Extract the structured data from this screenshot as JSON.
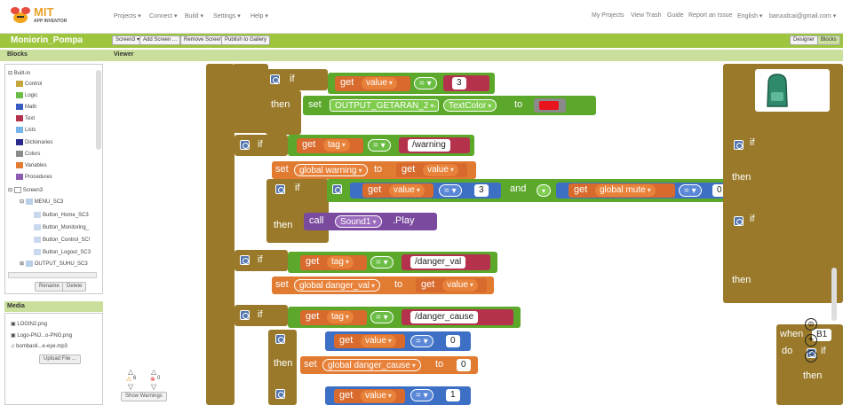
{
  "app": {
    "name": "MIT",
    "subtitle": "APP INVENTOR"
  },
  "nav": {
    "left": [
      "Projects ▾",
      "Connect ▾",
      "Build ▾",
      "Settings ▾",
      "Help ▾"
    ],
    "right": [
      "My Projects",
      "View Trash",
      "Guide",
      "Report an Issue",
      "English ▾",
      "baruudcai@gmail.com ▾"
    ]
  },
  "project": {
    "name": "Moniorin_Pompa",
    "screen_select": "Screen3 ▾",
    "buttons": [
      "Add Screen ...",
      "Remove Screen",
      "Publish to Gallery"
    ],
    "designer": "Designer",
    "blocks": "Blocks"
  },
  "sections": {
    "blocks": "Blocks",
    "viewer": "Viewer",
    "media": "Media"
  },
  "tree": {
    "builtin": "Built-in",
    "builtins": [
      {
        "label": "Control",
        "color": "#c4a43b"
      },
      {
        "label": "Logic",
        "color": "#6cbd45"
      },
      {
        "label": "Math",
        "color": "#3a5cc0"
      },
      {
        "label": "Text",
        "color": "#b5324d"
      },
      {
        "label": "Lists",
        "color": "#74b4e8"
      },
      {
        "label": "Dictionaries",
        "color": "#2a2a8e"
      },
      {
        "label": "Colors",
        "color": "#8a8a8a"
      },
      {
        "label": "Variables",
        "color": "#e07b31"
      },
      {
        "label": "Procedures",
        "color": "#8c5cb0"
      }
    ],
    "screen": "Screen3",
    "menu": "MENU_SC3",
    "children": [
      "Button_Home_SC3",
      "Button_Monitoring_",
      "Button_Control_SC!",
      "Button_Logout_SC3"
    ],
    "output": "OUTPUT_SUHU_SC3",
    "rename": "Rename",
    "delete": "Delete"
  },
  "media": {
    "files": [
      "LOGIN2.png",
      "Logo-PNJ...o-PNG.png",
      "bombasti...e-eye.mp3"
    ],
    "upload": "Upload File ..."
  },
  "warnings": {
    "warn_count": "6",
    "err_count": "0",
    "show": "Show Warnings"
  },
  "blocks": {
    "if": "if",
    "then": "then",
    "get": "get",
    "set": "set",
    "to": "to",
    "and": "and",
    "call": "call",
    "eq": "= ▾",
    "value": "value",
    "tag": "tag",
    "val3": "3",
    "output_comp": "OUTPUT_GETARAN_2",
    "text_color": "TextColor",
    "warning_str": "/warning",
    "global_warning": "global warning",
    "global_mute": "global mute",
    "num3": "3",
    "num0": "0",
    "sound": "Sound1",
    "play": ".Play",
    "danger_val_str": "/danger_val",
    "global_danger_val": "global danger_val",
    "danger_cause_str": "/danger_cause",
    "global_danger_cause": "global danger_cause",
    "num1": "1",
    "when": "when",
    "b1": "B1",
    "do": "do",
    "red": "#e8141e"
  }
}
